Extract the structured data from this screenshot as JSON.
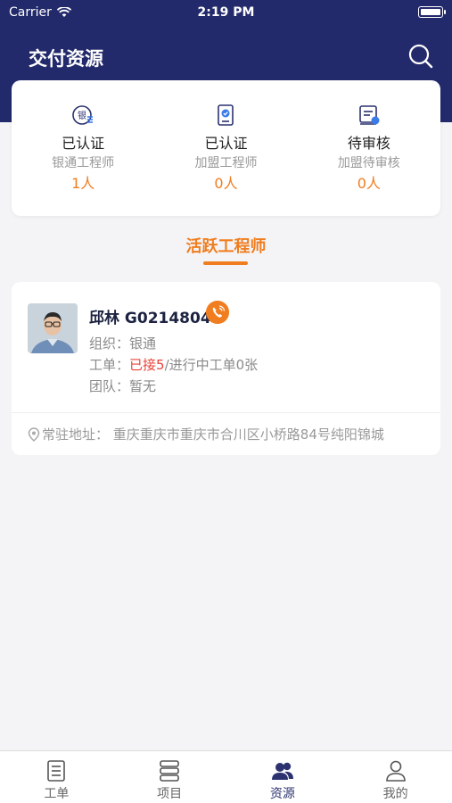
{
  "status_bar": {
    "carrier": "Carrier",
    "time": "2:19 PM"
  },
  "header": {
    "title": "交付资源"
  },
  "stats": [
    {
      "title": "已认证",
      "subtitle": "银通工程师",
      "count": "1人",
      "icon": "yin-badge-icon"
    },
    {
      "title": "已认证",
      "subtitle": "加盟工程师",
      "count": "0人",
      "icon": "certified-doc-icon"
    },
    {
      "title": "待审核",
      "subtitle": "加盟待审核",
      "count": "0人",
      "icon": "pending-review-icon"
    }
  ],
  "section": {
    "title": "活跃工程师"
  },
  "engineer": {
    "name": "邱林 G0214804",
    "org_label": "组织：",
    "org_value": "银通",
    "order_label": "工单：",
    "order_accepted": "已接5",
    "order_rest": "/进行中工单0张",
    "team_label": "团队：",
    "team_value": "暂无",
    "address": "常驻地址： 重庆重庆市重庆市合川区小桥路84号纯阳锦城"
  },
  "tabs": [
    {
      "label": "工单",
      "icon": "work-order-icon"
    },
    {
      "label": "项目",
      "icon": "project-icon"
    },
    {
      "label": "资源",
      "icon": "resource-people-icon"
    },
    {
      "label": "我的",
      "icon": "profile-icon"
    }
  ],
  "colors": {
    "navy": "#232a6b",
    "accent": "#f07d1f",
    "highlight": "#e8443a"
  }
}
